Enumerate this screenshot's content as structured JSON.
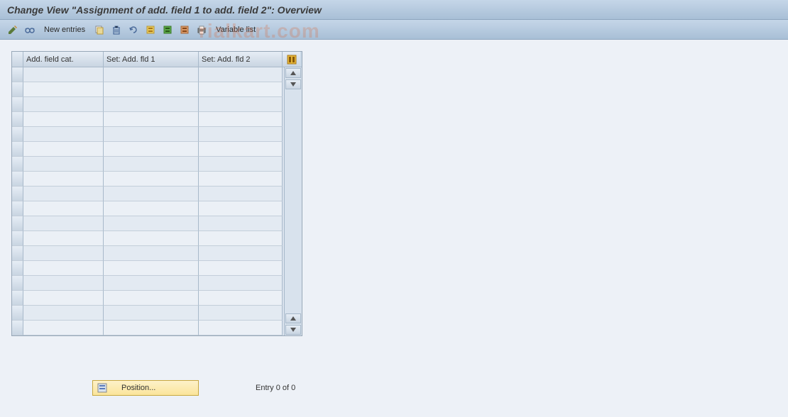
{
  "header": {
    "title": "Change View \"Assignment of add. field 1 to add. field 2\": Overview"
  },
  "toolbar": {
    "new_entries_label": "New entries",
    "variable_list_label": "Variable list",
    "icons": {
      "change": "change-icon",
      "checklist": "checklist-icon",
      "copy": "copy-icon",
      "delete": "delete-icon",
      "undo": "undo-icon",
      "select_all": "select-all-icon",
      "select_block": "select-block-icon",
      "deselect_all": "deselect-all-icon",
      "print": "print-icon"
    }
  },
  "table": {
    "columns": {
      "col1": "Add. field cat.",
      "col2": "Set: Add. fld 1",
      "col3": "Set: Add. fld 2"
    },
    "row_count": 18
  },
  "footer": {
    "position_label": "Position...",
    "entry_text": "Entry 0 of 0"
  },
  "watermark": "rialkart.com"
}
